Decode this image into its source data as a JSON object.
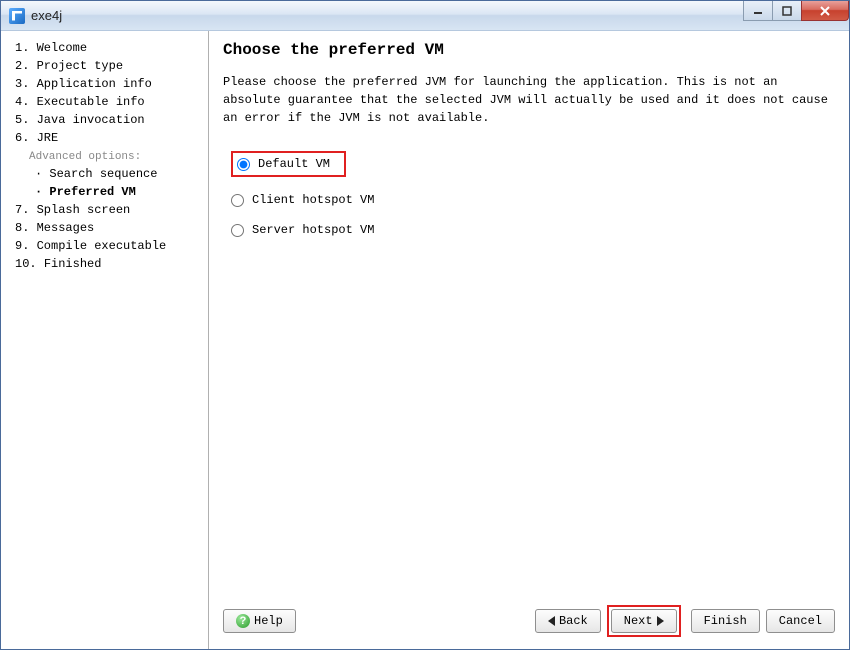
{
  "title": "exe4j",
  "watermark": "exe4j",
  "sidebar": {
    "items": [
      {
        "n": "1.",
        "label": "Welcome"
      },
      {
        "n": "2.",
        "label": "Project type"
      },
      {
        "n": "3.",
        "label": "Application info"
      },
      {
        "n": "4.",
        "label": "Executable info"
      },
      {
        "n": "5.",
        "label": "Java invocation"
      },
      {
        "n": "6.",
        "label": "JRE"
      }
    ],
    "advanced_label": "Advanced options:",
    "sub_items": [
      {
        "bullet": "·",
        "label": "Search sequence"
      },
      {
        "bullet": "·",
        "label": "Preferred VM",
        "bold": true
      }
    ],
    "items2": [
      {
        "n": "7.",
        "label": "Splash screen"
      },
      {
        "n": "8.",
        "label": "Messages"
      },
      {
        "n": "9.",
        "label": "Compile executable"
      },
      {
        "n": "10.",
        "label": "Finished"
      }
    ]
  },
  "main": {
    "heading": "Choose the preferred VM",
    "description": "Please choose the preferred JVM for launching the application. This is not an absolute guarantee that the selected JVM will actually be used and it does not cause an error if the JVM is not available.",
    "options": [
      {
        "label": "Default VM",
        "checked": true,
        "highlight": true
      },
      {
        "label": "Client hotspot VM",
        "checked": false,
        "highlight": false
      },
      {
        "label": "Server hotspot VM",
        "checked": false,
        "highlight": false
      }
    ]
  },
  "buttons": {
    "help": "Help",
    "back": "Back",
    "next": "Next",
    "finish": "Finish",
    "cancel": "Cancel"
  }
}
